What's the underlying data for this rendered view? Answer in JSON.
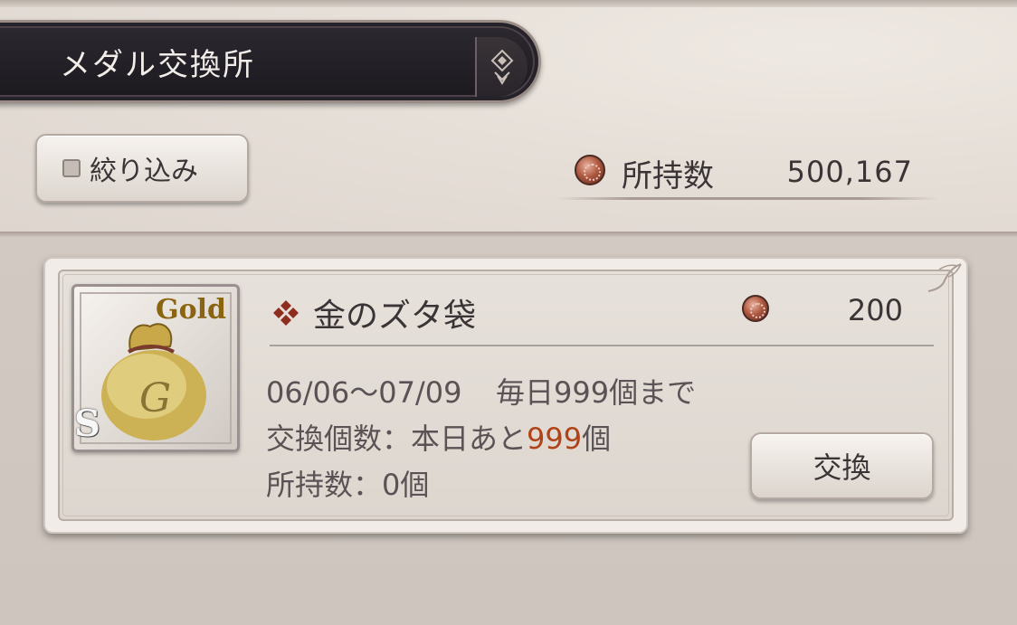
{
  "header": {
    "title": "メダル交換所",
    "filter_label": "絞り込み",
    "owned_label": "所持数",
    "owned_value": "500,167"
  },
  "item": {
    "name": "金のズタ袋",
    "price": "200",
    "icon_text": "Gold",
    "rank": "S",
    "period": "06/06〜07/09",
    "limit": "毎日999個まで",
    "remaining_prefix": "交換個数：本日あと",
    "remaining_count": "999",
    "remaining_suffix": "個",
    "held": "所持数：0個",
    "exchange_label": "交換"
  },
  "icons": {
    "title_cap": "diamond-emblem-icon",
    "medal": "medal-icon",
    "item_marker": "four-diamond-icon",
    "item_image": "gold-sack-icon"
  },
  "colors": {
    "highlight": "#b04318",
    "banner": "#26222a",
    "text": "#3a3436"
  }
}
